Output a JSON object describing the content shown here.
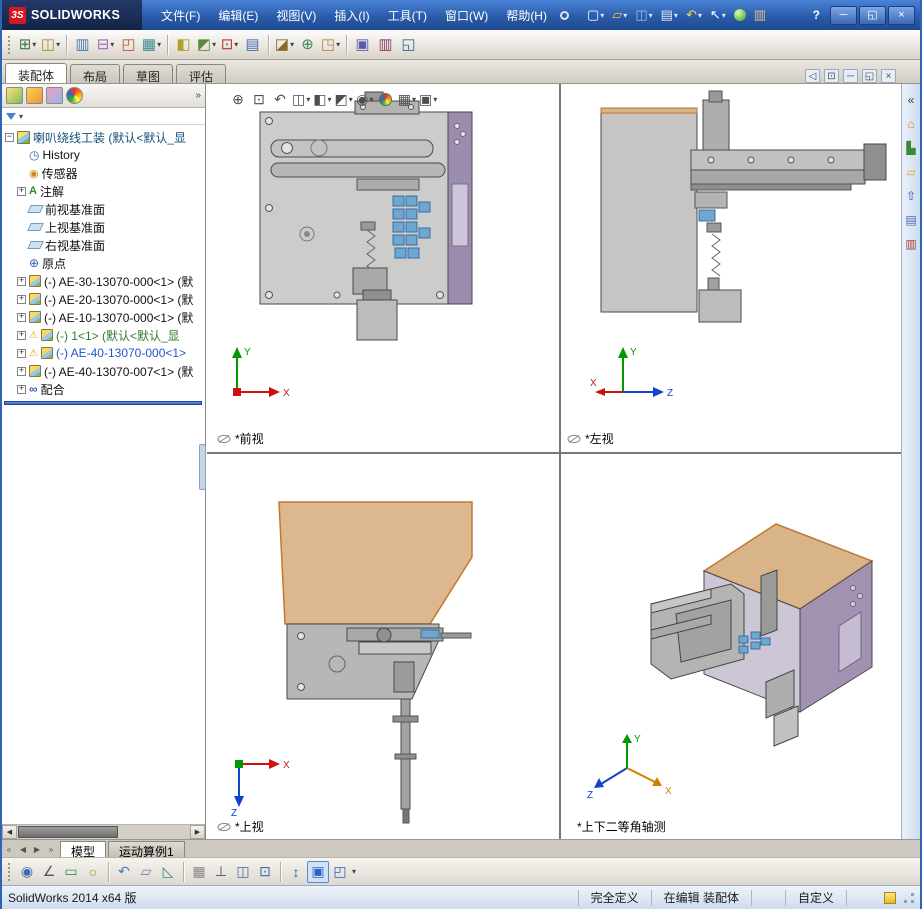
{
  "titlebar": {
    "logo_mark": "3S",
    "logo_text": "SOLIDWORKS",
    "menus": [
      "文件(F)",
      "编辑(E)",
      "视图(V)",
      "插入(I)",
      "工具(T)",
      "窗口(W)",
      "帮助(H)"
    ],
    "window_buttons": {
      "help": "?",
      "minimize": "─",
      "maximize": "◱",
      "close": "×"
    }
  },
  "command_tabs": {
    "items": [
      "装配体",
      "布局",
      "草图",
      "评估"
    ],
    "active": "装配体"
  },
  "feature_panel": {
    "tree": [
      {
        "label": "喇叭绕线工装 (默认<默认_显"
      },
      {
        "label": "History"
      },
      {
        "label": "传感器"
      },
      {
        "label": "注解"
      },
      {
        "label": "前视基准面"
      },
      {
        "label": "上视基准面"
      },
      {
        "label": "右视基准面"
      },
      {
        "label": "原点"
      },
      {
        "label": "(-) AE-30-13070-000<1> (默"
      },
      {
        "label": "(-) AE-20-13070-000<1> (默"
      },
      {
        "label": "(-) AE-10-13070-000<1> (默"
      },
      {
        "label": "(-) 1<1> (默认<默认_显"
      },
      {
        "label": "(-) AE-40-13070-000<1>"
      },
      {
        "label": "(-) AE-40-13070-007<1> (默"
      },
      {
        "label": "配合"
      }
    ]
  },
  "viewports": {
    "front": {
      "label": "*前视"
    },
    "left": {
      "label": "*左视"
    },
    "top": {
      "label": "*上视"
    },
    "iso": {
      "label": "*上下二等角轴测"
    },
    "axis": {
      "x": "X",
      "y": "Y",
      "z": "Z"
    }
  },
  "model_tabs": {
    "items": [
      "模型",
      "运动算例1"
    ],
    "active": "模型"
  },
  "statusbar": {
    "app_version": "SolidWorks 2014 x64 版",
    "definition": "完全定义",
    "editing": "在编辑 装配体",
    "custom": "自定义"
  },
  "colors": {
    "accent_blue": "#2a5cab",
    "panel_purple": "#a192b1",
    "panel_tan": "#d9b489",
    "highlight_part_blue": "#6ea7d2"
  }
}
